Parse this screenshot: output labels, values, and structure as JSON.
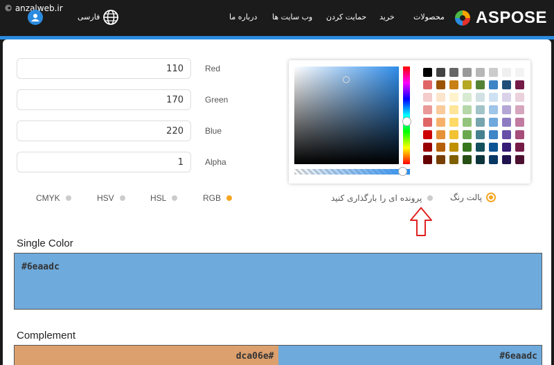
{
  "watermark": "© anzalweb.ir",
  "nav": {
    "language": "فارسی",
    "items": [
      "درباره ما",
      "وب سایت ها",
      "حمایت کردن",
      "خرید",
      "محصولات"
    ],
    "logo": "ASPOSE"
  },
  "fields": [
    {
      "value": "110",
      "label": "Red"
    },
    {
      "value": "170",
      "label": "Green"
    },
    {
      "value": "220",
      "label": "Blue"
    },
    {
      "value": "1",
      "label": "Alpha"
    }
  ],
  "modes": [
    {
      "label": "CMYK",
      "active": false
    },
    {
      "label": "HSV",
      "active": false
    },
    {
      "label": "HSL",
      "active": false
    },
    {
      "label": "RGB",
      "active": true
    }
  ],
  "picker": {
    "sources": [
      {
        "label": "پالت رنگ",
        "selected": true
      },
      {
        "label": "پرونده ای را بارگذاری کنید",
        "selected": false
      }
    ],
    "swatch_colors": [
      "#000000",
      "#434343",
      "#666666",
      "#999999",
      "#b7b7b7",
      "#cccccc",
      "#efefef",
      "#f3f3f3",
      "#e06666",
      "#9c5300",
      "#c88014",
      "#b5a823",
      "#548235",
      "#3d85c6",
      "#1f4e79",
      "#741b47",
      "#f4cccc",
      "#fce5cd",
      "#fff2cc",
      "#d9ead3",
      "#d0e0e3",
      "#cfe2f3",
      "#d9d2e9",
      "#ead1dc",
      "#ea9999",
      "#f9cb9c",
      "#ffe599",
      "#b6d7a8",
      "#a2c4c9",
      "#9fc5e8",
      "#b4a7d6",
      "#d5a6bd",
      "#e06666",
      "#f6b26b",
      "#ffd966",
      "#93c47d",
      "#76a5af",
      "#6fa8dc",
      "#8e7cc3",
      "#c27ba0",
      "#cc0000",
      "#e69138",
      "#f1c232",
      "#6aa84f",
      "#45818e",
      "#3d85c6",
      "#674ea7",
      "#a64d79",
      "#990000",
      "#b45f06",
      "#bf9000",
      "#38761d",
      "#134f5c",
      "#0b5394",
      "#351c75",
      "#741b47",
      "#660000",
      "#783f04",
      "#7f6000",
      "#274e13",
      "#0c343d",
      "#073763",
      "#20124d",
      "#4c1130"
    ]
  },
  "single": {
    "title": "Single Color",
    "hex": "#6eaadc",
    "color": "#6eaadc"
  },
  "complement": {
    "title": "Complement",
    "left_hex": "dca06e#",
    "left_color": "#dca06e",
    "right_hex": "#6eaadc",
    "right_color": "#6eaadc"
  }
}
